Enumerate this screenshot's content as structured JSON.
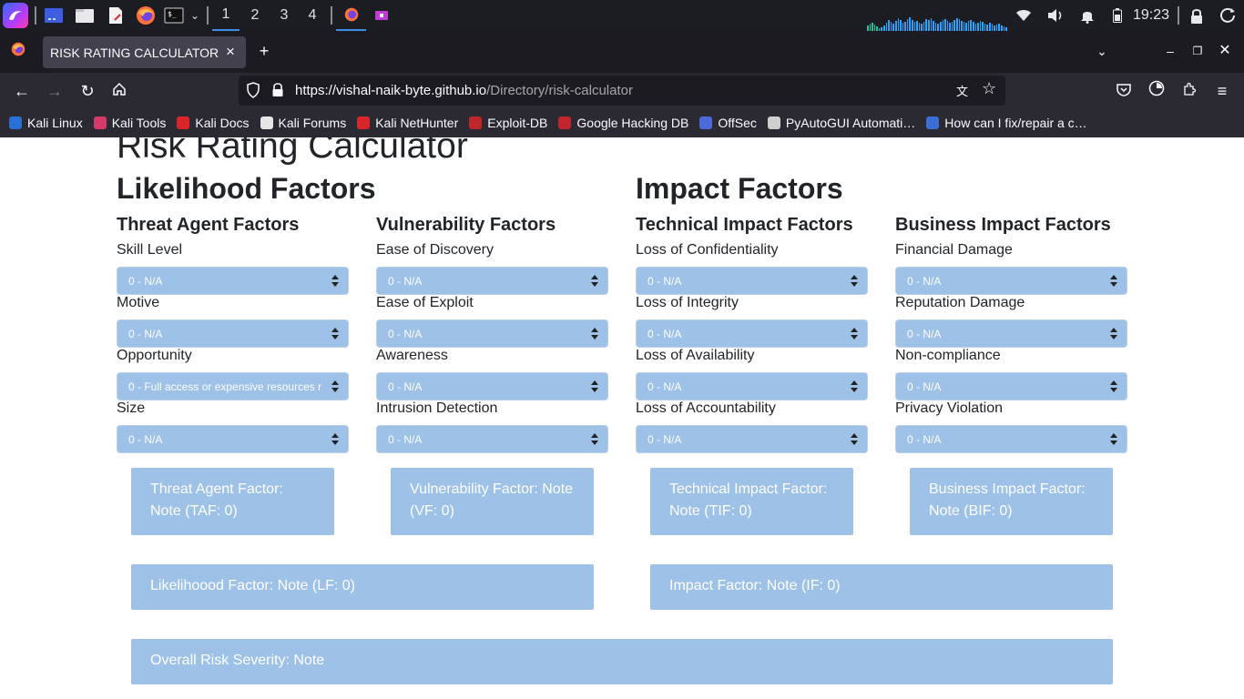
{
  "panel": {
    "workspaces": [
      "1",
      "2",
      "3",
      "4"
    ],
    "active_workspace": "1",
    "clock": "19:23",
    "icons": [
      "kali-menu-icon",
      "show-desktop-icon",
      "file-manager-icon",
      "text-editor-icon",
      "firefox-icon",
      "terminal-icon",
      "chevron-down-icon",
      "firefox-window-icon",
      "app-window-icon",
      "wifi-icon",
      "volume-icon",
      "notification-bell-icon",
      "battery-icon",
      "lock-icon",
      "power-icon"
    ]
  },
  "browser": {
    "tab_title": "RISK RATING CALCULATOR",
    "url_host": "https://vishal-naik-byte.github.io",
    "url_path": "/Directory/risk-calculator",
    "bookmarks": [
      {
        "label": "Kali Linux",
        "icon": "kali-icon",
        "color": "#2a6fd6"
      },
      {
        "label": "Kali Tools",
        "icon": "kali-tools-icon",
        "color": "#d63a6a"
      },
      {
        "label": "Kali Docs",
        "icon": "kali-docs-icon",
        "color": "#d9252a"
      },
      {
        "label": "Kali Forums",
        "icon": "kali-forums-icon",
        "color": "#e6e6e6"
      },
      {
        "label": "Kali NetHunter",
        "icon": "nethunter-icon",
        "color": "#d9252a"
      },
      {
        "label": "Exploit-DB",
        "icon": "exploit-db-icon",
        "color": "#c0262b"
      },
      {
        "label": "Google Hacking DB",
        "icon": "ghdb-icon",
        "color": "#c0262b"
      },
      {
        "label": "OffSec",
        "icon": "offsec-icon",
        "color": "#4b6bd8"
      },
      {
        "label": "PyAutoGUI  Automati…",
        "icon": "pyautogui-icon",
        "color": "#cfcfcf"
      },
      {
        "label": "How can I fix/repair a c…",
        "icon": "stackexchange-icon",
        "color": "#3a6fd6"
      }
    ]
  },
  "page": {
    "title": "Risk Rating Calculator",
    "likelihood_title": "Likelihood Factors",
    "impact_title": "Impact Factors",
    "groups": [
      {
        "title": "Threat Agent Factors",
        "fields": [
          {
            "label": "Skill Level",
            "value": "0 - N/A"
          },
          {
            "label": "Motive",
            "value": "0 - N/A"
          },
          {
            "label": "Opportunity",
            "value": "0 - Full access or expensive resources r"
          },
          {
            "label": "Size",
            "value": "0 - N/A"
          }
        ],
        "result": "Threat Agent Factor: Note (TAF: 0)"
      },
      {
        "title": "Vulnerability Factors",
        "fields": [
          {
            "label": "Ease of Discovery",
            "value": "0 - N/A"
          },
          {
            "label": "Ease of Exploit",
            "value": "0 - N/A"
          },
          {
            "label": "Awareness",
            "value": "0 - N/A"
          },
          {
            "label": "Intrusion Detection",
            "value": "0 - N/A"
          }
        ],
        "result": "Vulnerability Factor: Note (VF: 0)"
      },
      {
        "title": "Technical Impact Factors",
        "fields": [
          {
            "label": "Loss of Confidentiality",
            "value": "0 - N/A"
          },
          {
            "label": "Loss of Integrity",
            "value": "0 - N/A"
          },
          {
            "label": "Loss of Availability",
            "value": "0 - N/A"
          },
          {
            "label": "Loss of Accountability",
            "value": "0 - N/A"
          }
        ],
        "result": "Technical Impact Factor: Note (TIF: 0)"
      },
      {
        "title": "Business Impact Factors",
        "fields": [
          {
            "label": "Financial Damage",
            "value": "0 - N/A"
          },
          {
            "label": "Reputation Damage",
            "value": "0 - N/A"
          },
          {
            "label": "Non-compliance",
            "value": "0 - N/A"
          },
          {
            "label": "Privacy Violation",
            "value": "0 - N/A"
          }
        ],
        "result": "Business Impact Factor: Note (BIF: 0)"
      }
    ],
    "likelihood_result": "Likelihoood Factor: Note (LF: 0)",
    "impact_result": "Impact Factor: Note (IF: 0)",
    "overall_result": "Overall Risk Severity: Note"
  }
}
